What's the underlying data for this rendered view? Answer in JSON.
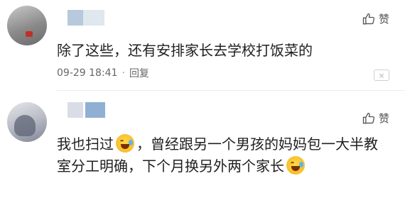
{
  "comments": [
    {
      "like_label": "赞",
      "text": "除了这些，还有安排家长去学校打饭菜的",
      "timestamp": "09-29 18:41",
      "separator": "·",
      "reply_label": "回复",
      "close_glyph": "×",
      "icons": {
        "like": "thumbs-up-icon",
        "close": "close-icon"
      }
    },
    {
      "like_label": "赞",
      "text_part1": "我也扫过",
      "text_part2": "，曾经跟另一个男孩的妈妈包一大半教室分工明确，下个月换另外两个家长",
      "emoji": "laughing-crying-emoji",
      "icons": {
        "like": "thumbs-up-icon"
      }
    }
  ]
}
